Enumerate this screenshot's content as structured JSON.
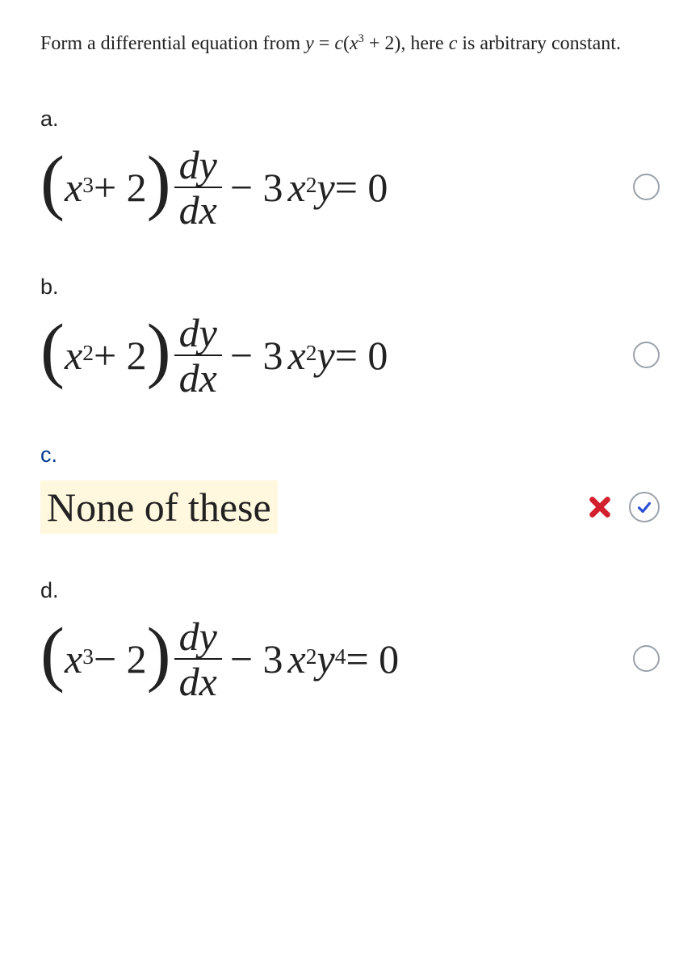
{
  "question": {
    "prefix": "Form a differential equation from ",
    "equation_lhs": "y",
    "equation_eq": " = ",
    "equation_c": "c",
    "equation_open": "(",
    "equation_x": "x",
    "equation_exp": "3",
    "equation_plus2": " + 2",
    "equation_close": ")",
    "middle": ", here ",
    "const": "c",
    "suffix": " is arbitrary constant."
  },
  "options": {
    "a": {
      "label": "a.",
      "open": "(",
      "x1": "x",
      "exp1": "3",
      "mid1": " + 2",
      "close": ")",
      "frac_num": "dy",
      "frac_den": "dx",
      "minus": " − 3",
      "x2": "x",
      "exp2": "2",
      "y": "y",
      "eq": " = 0"
    },
    "b": {
      "label": "b.",
      "open": "(",
      "x1": "x",
      "exp1": "2",
      "mid1": " + 2",
      "close": ")",
      "frac_num": "dy",
      "frac_den": "dx",
      "minus": " − 3",
      "x2": "x",
      "exp2": "2",
      "y": "y",
      "eq": " = 0"
    },
    "c": {
      "label": "c.",
      "text": "None of these"
    },
    "d": {
      "label": "d.",
      "open": "(",
      "x1": "x",
      "exp1": "3",
      "mid1": " − 2",
      "close": ")",
      "frac_num": "dy",
      "frac_den": "dx",
      "minus": " − 3",
      "x2": "x",
      "exp2": "2",
      "y": "y",
      "yexp": "4",
      "eq": " = 0"
    }
  },
  "feedback": {
    "selected_option": "c",
    "is_correct": false
  }
}
